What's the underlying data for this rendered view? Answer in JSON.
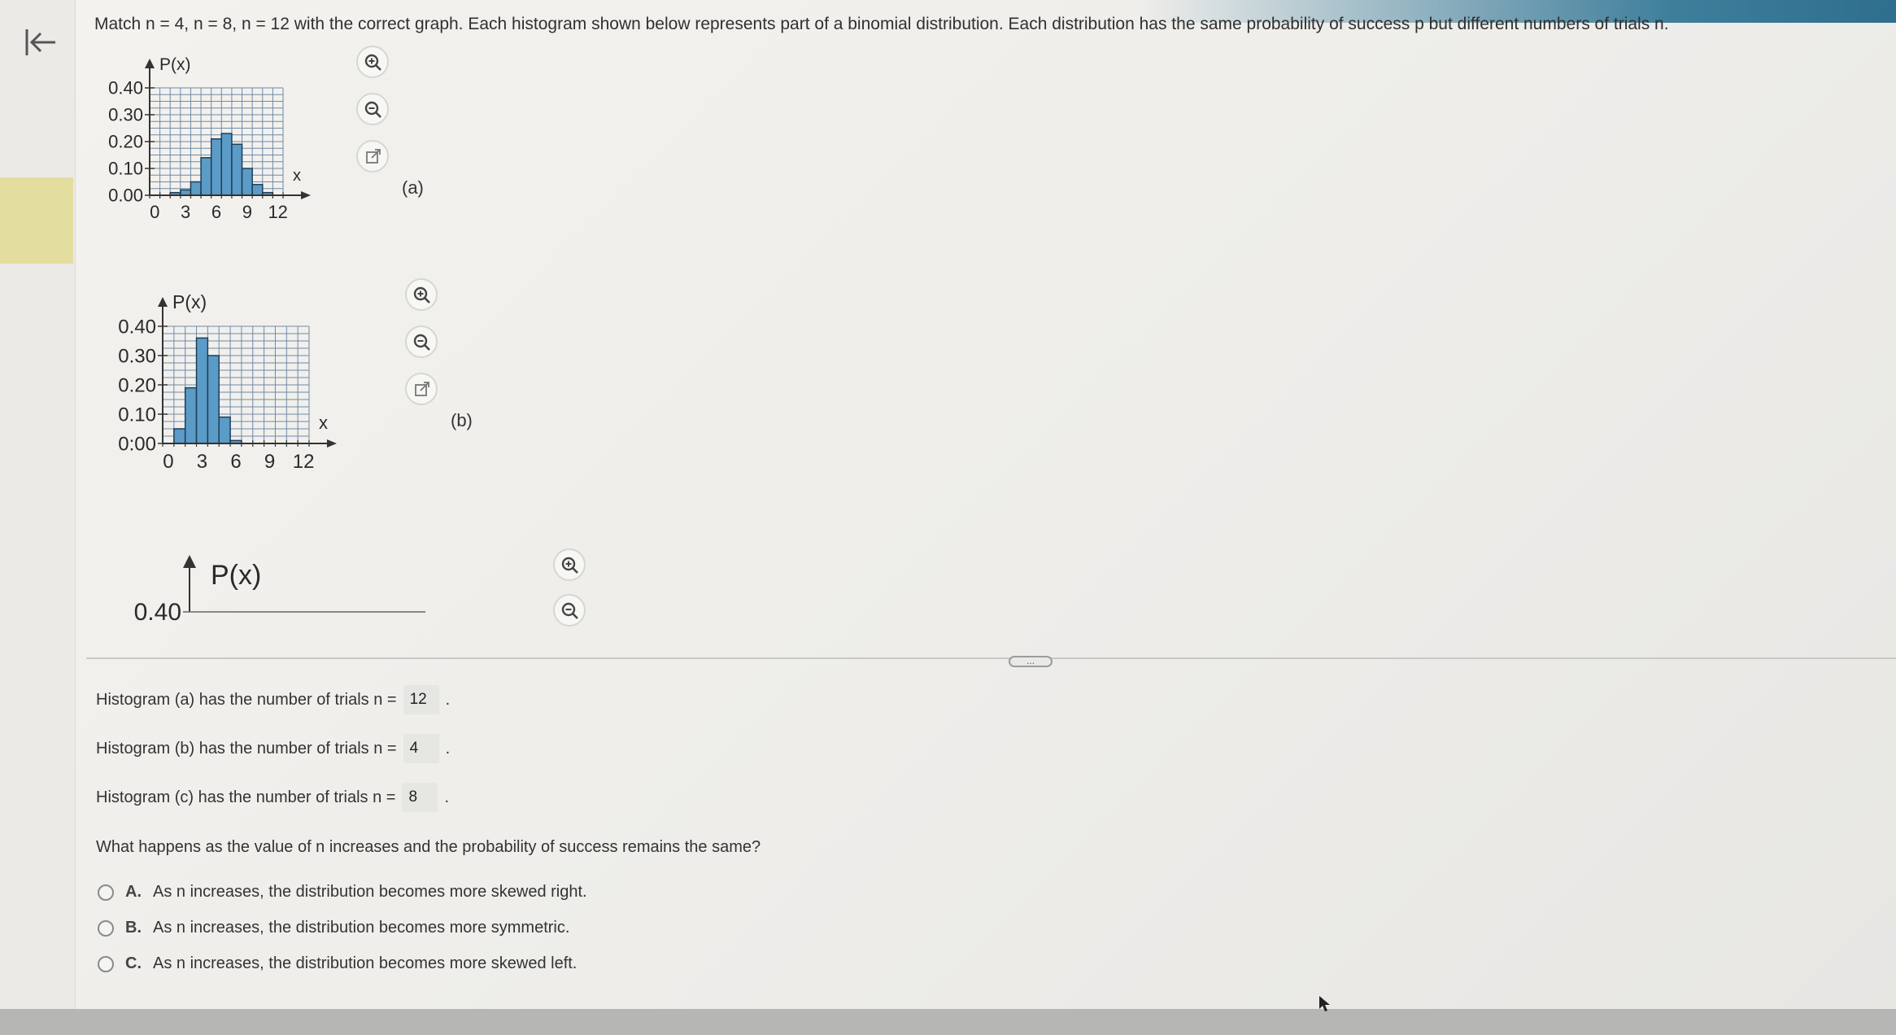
{
  "question": {
    "text": "Match n = 4, n = 8, n = 12 with the correct graph. Each histogram shown below represents part of a binomial distribution. Each distribution has the same probability of success p but different numbers of trials n."
  },
  "histograms": {
    "a": {
      "label": "(a)"
    },
    "b": {
      "label": "(b)"
    }
  },
  "chart_data": [
    {
      "type": "bar",
      "title": "",
      "ylabel": "P(x)",
      "xlabel": "x",
      "ylim": [
        0,
        0.4
      ],
      "xlim": [
        0,
        12
      ],
      "yticks": [
        "0.00",
        "0.10",
        "0.20",
        "0.30",
        "0.40"
      ],
      "xticks": [
        "0",
        "3",
        "6",
        "9",
        "12"
      ],
      "grid": true,
      "x": [
        0,
        1,
        2,
        3,
        4,
        5,
        6,
        7,
        8,
        9,
        10,
        11,
        12
      ],
      "values": [
        0.0,
        0.0,
        0.01,
        0.02,
        0.05,
        0.14,
        0.21,
        0.23,
        0.19,
        0.1,
        0.04,
        0.01,
        0.0
      ]
    },
    {
      "type": "bar",
      "title": "",
      "ylabel": "P(x)",
      "xlabel": "x",
      "ylim": [
        0,
        0.4
      ],
      "xlim": [
        0,
        12
      ],
      "yticks": [
        "0:00",
        "0.10",
        "0.20",
        "0.30",
        "0.40"
      ],
      "xticks": [
        "0",
        "3",
        "6",
        "9",
        "12"
      ],
      "grid": true,
      "x": [
        0,
        1,
        2,
        3,
        4,
        5,
        6,
        7,
        8,
        9,
        10,
        11,
        12
      ],
      "values": [
        0.0,
        0.05,
        0.19,
        0.36,
        0.3,
        0.09,
        0.01,
        0.0,
        0.0,
        0.0,
        0.0,
        0.0,
        0.0
      ]
    },
    {
      "type": "bar",
      "title": "",
      "ylabel": "P(x)",
      "ytick_visible": "0.40"
    }
  ],
  "answers": [
    {
      "text": "Histogram (a) has the number of trials n =",
      "value": "12"
    },
    {
      "text": "Histogram (b) has the number of trials n =",
      "value": "4"
    },
    {
      "text": "Histogram (c) has the number of trials n =",
      "value": "8"
    }
  ],
  "prompt": "What happens as the value of n increases and the probability of success remains the same?",
  "options": [
    {
      "letter": "A.",
      "text": "As n increases, the distribution becomes more skewed right."
    },
    {
      "letter": "B.",
      "text": "As n increases, the distribution becomes more symmetric."
    },
    {
      "letter": "C.",
      "text": "As n increases, the distribution becomes more skewed left."
    }
  ],
  "more_button": "...",
  "colors": {
    "bar_fill": "#5b9bc8",
    "bar_stroke": "#1d3f57",
    "grid": "#6f8aa8",
    "topbar": "#2f6e8e",
    "yellow_tab": "#e3dd9e"
  },
  "icons": [
    "back-arrow-icon",
    "zoom-in-icon",
    "zoom-out-icon",
    "popout-icon"
  ]
}
